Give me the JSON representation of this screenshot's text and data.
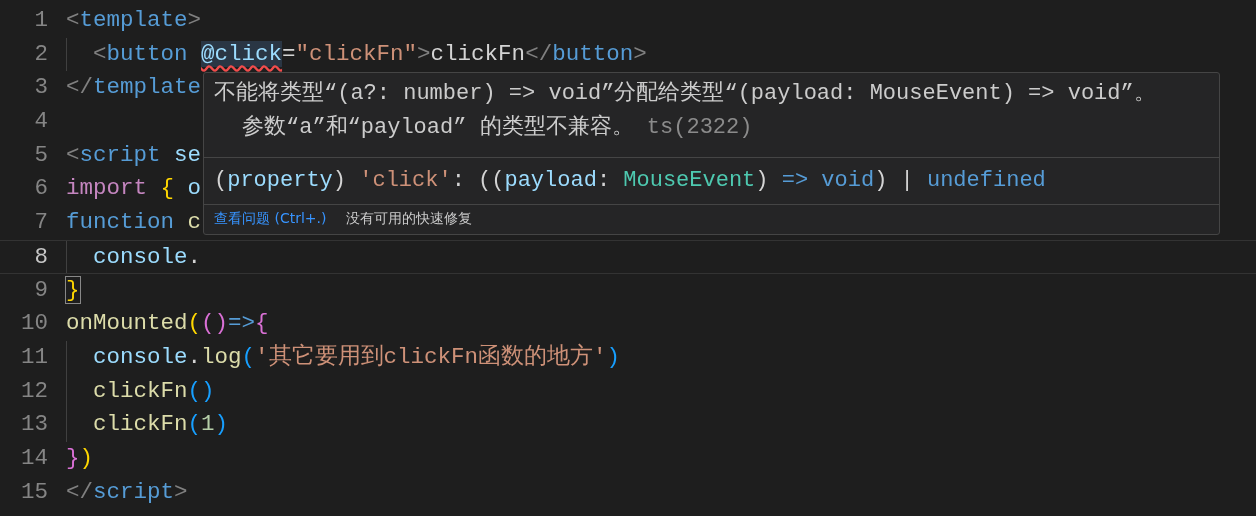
{
  "editor": {
    "lines": [
      {
        "number": "1",
        "current": false,
        "indented": false,
        "tokens": [
          {
            "kind": "punct",
            "text": "<"
          },
          {
            "kind": "tag",
            "text": "template"
          },
          {
            "kind": "punct",
            "text": ">"
          }
        ]
      },
      {
        "number": "2",
        "current": false,
        "indented": true,
        "tokens": [
          {
            "kind": "punct",
            "text": "<"
          },
          {
            "kind": "tag",
            "text": "button "
          },
          {
            "kind": "attr",
            "text": "@click",
            "error": true,
            "highlighted": true
          },
          {
            "kind": "text",
            "text": "="
          },
          {
            "kind": "string",
            "text": "\"clickFn\""
          },
          {
            "kind": "punct",
            "text": ">"
          },
          {
            "kind": "text",
            "text": "clickFn"
          },
          {
            "kind": "punct",
            "text": "</"
          },
          {
            "kind": "tag",
            "text": "button"
          },
          {
            "kind": "punct",
            "text": ">"
          }
        ]
      },
      {
        "number": "3",
        "current": false,
        "indented": false,
        "tokens": [
          {
            "kind": "punct",
            "text": "</"
          },
          {
            "kind": "tag",
            "text": "template"
          }
        ]
      },
      {
        "number": "4",
        "current": false,
        "indented": false
      },
      {
        "number": "5",
        "current": false,
        "indented": false,
        "tokens": [
          {
            "kind": "punct",
            "text": "<"
          },
          {
            "kind": "tag",
            "text": "script "
          },
          {
            "kind": "attr",
            "text": "se"
          }
        ]
      },
      {
        "number": "6",
        "current": false,
        "indented": false,
        "tokens": [
          {
            "kind": "control",
            "text": "import "
          },
          {
            "kind": "bracket1",
            "text": "{ "
          },
          {
            "kind": "variable",
            "text": "o"
          }
        ]
      },
      {
        "number": "7",
        "current": false,
        "indented": false,
        "tokens": [
          {
            "kind": "keyword",
            "text": "function "
          },
          {
            "kind": "function",
            "text": "c"
          }
        ]
      },
      {
        "number": "8",
        "current": true,
        "indented": true,
        "tokens": [
          {
            "kind": "variable",
            "text": "console"
          },
          {
            "kind": "text",
            "text": "."
          }
        ]
      },
      {
        "number": "9",
        "current": false,
        "indented": false,
        "tokens": [
          {
            "kind": "bracket1",
            "text": "}",
            "matched": true
          }
        ]
      },
      {
        "number": "10",
        "current": false,
        "indented": false,
        "tokens": [
          {
            "kind": "function",
            "text": "onMounted"
          },
          {
            "kind": "bracket1",
            "text": "("
          },
          {
            "kind": "bracket2",
            "text": "()"
          },
          {
            "kind": "keyword",
            "text": "=>"
          },
          {
            "kind": "bracket2",
            "text": "{"
          }
        ]
      },
      {
        "number": "11",
        "current": false,
        "indented": true,
        "tokens": [
          {
            "kind": "variable",
            "text": "console"
          },
          {
            "kind": "text",
            "text": "."
          },
          {
            "kind": "function",
            "text": "log"
          },
          {
            "kind": "bracket3",
            "text": "("
          },
          {
            "kind": "string",
            "text": "'其它要用到clickFn函数的地方'"
          },
          {
            "kind": "bracket3",
            "text": ")"
          }
        ]
      },
      {
        "number": "12",
        "current": false,
        "indented": true,
        "tokens": [
          {
            "kind": "function",
            "text": "clickFn"
          },
          {
            "kind": "bracket3",
            "text": "()"
          }
        ]
      },
      {
        "number": "13",
        "current": false,
        "indented": true,
        "tokens": [
          {
            "kind": "function",
            "text": "clickFn"
          },
          {
            "kind": "bracket3",
            "text": "("
          },
          {
            "kind": "number",
            "text": "1"
          },
          {
            "kind": "bracket3",
            "text": ")"
          }
        ]
      },
      {
        "number": "14",
        "current": false,
        "indented": false,
        "tokens": [
          {
            "kind": "bracket2",
            "text": "}"
          },
          {
            "kind": "bracket1",
            "text": ")"
          }
        ]
      },
      {
        "number": "15",
        "current": false,
        "indented": false,
        "tokens": [
          {
            "kind": "punct",
            "text": "</"
          },
          {
            "kind": "tag",
            "text": "script"
          },
          {
            "kind": "punct",
            "text": ">"
          }
        ]
      }
    ]
  },
  "hover": {
    "message": "不能将类型“(a?: number) => void”分配给类型“(payload: MouseEvent) => void”。",
    "detail": "参数“a”和“payload” 的类型不兼容。",
    "code": "ts(2322)",
    "signature": [
      {
        "kind": "text",
        "text": "("
      },
      {
        "kind": "variable",
        "text": "property"
      },
      {
        "kind": "text",
        "text": ") "
      },
      {
        "kind": "string",
        "text": "'click'"
      },
      {
        "kind": "text",
        "text": ": (("
      },
      {
        "kind": "variable",
        "text": "payload"
      },
      {
        "kind": "text",
        "text": ": "
      },
      {
        "kind": "type",
        "text": "MouseEvent"
      },
      {
        "kind": "text",
        "text": ") "
      },
      {
        "kind": "keyword",
        "text": "=> "
      },
      {
        "kind": "keyword",
        "text": "void"
      },
      {
        "kind": "text",
        "text": ") | "
      },
      {
        "kind": "keyword",
        "text": "undefined"
      }
    ],
    "view_problem": "查看问题 (Ctrl+.)",
    "no_fix": "没有可用的快速修复"
  }
}
